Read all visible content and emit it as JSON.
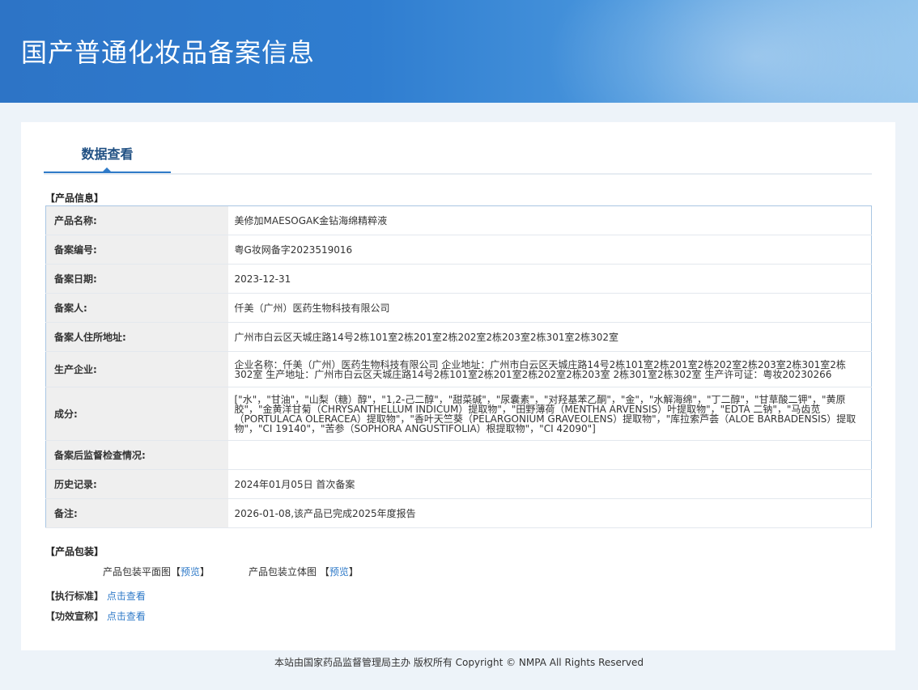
{
  "header": {
    "title": "国产普通化妆品备案信息"
  },
  "tabs": [
    {
      "label": "数据查看"
    }
  ],
  "product_section": {
    "title": "【产品信息】",
    "rows": [
      {
        "label": "产品名称:",
        "value": "美修加MAESOGAK金钻海绵精粹液"
      },
      {
        "label": "备案编号:",
        "value": "粤G妆网备字2023519016"
      },
      {
        "label": "备案日期:",
        "value": "2023-12-31"
      },
      {
        "label": "备案人:",
        "value": "仟美（广州）医药生物科技有限公司"
      },
      {
        "label": "备案人住所地址:",
        "value": "广州市白云区天城庄路14号2栋101室2栋201室2栋202室2栋203室2栋301室2栋302室"
      },
      {
        "label": "生产企业:",
        "value": "企业名称：仟美（广州）医药生物科技有限公司 企业地址：广州市白云区天城庄路14号2栋101室2栋201室2栋202室2栋203室2栋301室2栋302室 生产地址：广州市白云区天城庄路14号2栋101室2栋201室2栋202室2栋203室 2栋301室2栋302室 生产许可证：粤妆20230266"
      },
      {
        "label": "成分:",
        "value": "[\"水\"，\"甘油\"，\"山梨（糖）醇\"，\"1,2-己二醇\"，\"甜菜碱\"，\"尿囊素\"，\"对羟基苯乙酮\"，\"金\"，\"水解海绵\"，\"丁二醇\"，\"甘草酸二钾\"，\"黄原胶\"，\"金黄洋甘菊（CHRYSANTHELLUM INDICUM）提取物\"，\"田野薄荷（MENTHA ARVENSIS）叶提取物\"，\"EDTA 二钠\"，\"马齿苋（PORTULACA OLERACEA）提取物\"，\"香叶天竺葵（PELARGONIUM GRAVEOLENS）提取物\"，\"库拉索芦荟（ALOE BARBADENSIS）提取物\"，\"CI 19140\"，\"苦参（SOPHORA ANGUSTIFOLIA）根提取物\"，\"CI 42090\"]"
      },
      {
        "label": "备案后监督检查情况:",
        "value": ""
      },
      {
        "label": "历史记录:",
        "value": "2024年01月05日 首次备案"
      },
      {
        "label": "备注:",
        "value": "2026-01-08,该产品已完成2025年度报告"
      }
    ]
  },
  "packaging": {
    "title": "【产品包装】",
    "flat_label": "产品包装平面图",
    "solid_label": "产品包装立体图",
    "bracket_open": "【",
    "bracket_close": "】",
    "preview_link": "预览"
  },
  "standard": {
    "title": "【执行标准】",
    "link": "点击查看"
  },
  "efficacy": {
    "title": "【功效宣称】",
    "link": "点击查看"
  },
  "footer": {
    "text": "本站由国家药品监督管理局主办 版权所有 Copyright © NMPA All Rights Reserved"
  },
  "colors": {
    "header_blue": "#2f7dd0",
    "link_blue": "#2f7ac8",
    "tab_text": "#1f4f82"
  }
}
